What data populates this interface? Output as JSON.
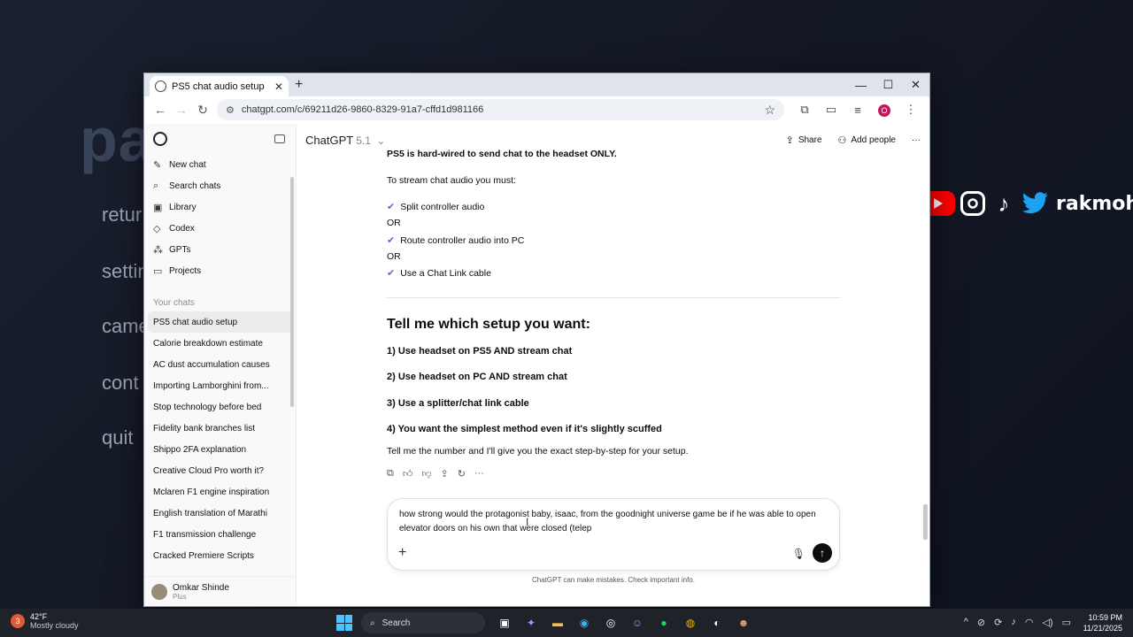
{
  "background": {
    "big_text": "pa",
    "menu": [
      "retur",
      "settin",
      "came",
      "cont",
      "quit"
    ],
    "overlay_name": "rakmohh"
  },
  "browser": {
    "tab_title": "PS5 chat audio setup",
    "url": "chatgpt.com/c/69211d26-9860-8329-91a7-cffd1d981166",
    "profile_initial": "O"
  },
  "sidebar": {
    "nav": [
      {
        "label": "New chat",
        "icon": "compose-icon"
      },
      {
        "label": "Search chats",
        "icon": "search-icon"
      },
      {
        "label": "Library",
        "icon": "library-icon"
      },
      {
        "label": "Codex",
        "icon": "codex-icon"
      },
      {
        "label": "GPTs",
        "icon": "gpts-icon"
      },
      {
        "label": "Projects",
        "icon": "folder-icon"
      }
    ],
    "section_label": "Your chats",
    "chats": [
      "PS5 chat audio setup",
      "Calorie breakdown estimate",
      "AC dust accumulation causes",
      "Importing Lamborghini from...",
      "Stop technology before bed",
      "Fidelity bank branches list",
      "Shippo 2FA explanation",
      "Creative Cloud Pro worth it?",
      "Mclaren F1 engine inspiration",
      "English translation of Marathi",
      "F1 transmission challenge",
      "Cracked Premiere Scripts"
    ],
    "user": {
      "name": "Omkar Shinde",
      "plan": "Plus"
    }
  },
  "header": {
    "model": "ChatGPT",
    "version": "5.1",
    "share_label": "Share",
    "add_people_label": "Add people"
  },
  "message": {
    "cut_line": "PS5 is hard-wired to send chat to the headset ONLY.",
    "intro": "To stream chat audio you must:",
    "check1": "Split controller audio",
    "or1": "OR",
    "check2": "Route controller audio into PC",
    "or2": "OR",
    "check3": "Use a Chat Link cable",
    "heading": "Tell me which setup you want:",
    "opt1": "1) Use headset on PS5 AND stream chat",
    "opt2": "2) Use headset on PC AND stream chat",
    "opt3": "3) Use a splitter/chat link cable",
    "opt4": "4) You want the simplest method even if it's slightly scuffed",
    "closing": "Tell me the number and I'll give you the exact step-by-step for your setup."
  },
  "composer": {
    "text": "how strong would the protagonist baby, isaac, from the goodnight universe game be if he was able to open elevator doors on his own that were closed (telep",
    "disclaimer": "ChatGPT can make mistakes. Check important info."
  },
  "taskbar": {
    "weather_temp": "42°F",
    "weather_desc": "Mostly cloudy",
    "weather_badge": "3",
    "search_label": "Search",
    "time": "10:59 PM",
    "date": "11/21/2025"
  }
}
